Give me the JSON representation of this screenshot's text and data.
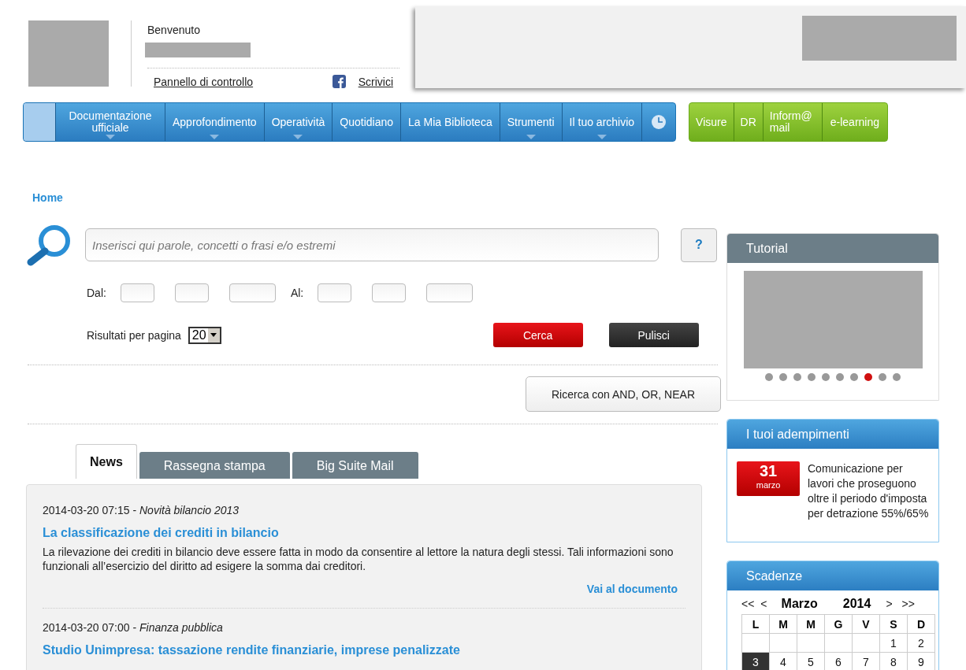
{
  "header": {
    "welcome": "Benvenuto",
    "links": [
      {
        "kind": "plain",
        "label": "Pannello di controllo"
      },
      {
        "kind": "facebook",
        "label": "Scrivici"
      }
    ]
  },
  "main_nav": [
    {
      "label": "Documentazione ufficiale",
      "dropdown": true
    },
    {
      "label": "Approfondimento",
      "dropdown": true
    },
    {
      "label": "Operatività",
      "dropdown": true
    },
    {
      "label": "Quotidiano",
      "dropdown": false
    },
    {
      "label": "La Mia Biblioteca",
      "dropdown": false
    },
    {
      "label": "Strumenti",
      "dropdown": true
    },
    {
      "label": "Il tuo archivio",
      "dropdown": true
    }
  ],
  "service_nav": [
    "Visure",
    "DR",
    "Inform@ mail",
    "e-learning"
  ],
  "breadcrumb": "Home",
  "search": {
    "placeholder": "Inserisci qui parole, concetti o frasi e/o estremi",
    "help": "?",
    "from_label": "Dal:",
    "to_label": "Al:",
    "per_page_label": "Risultati per pagina",
    "per_page": "20",
    "submit": "Cerca",
    "clear": "Pulisci",
    "advanced": "Ricerca con AND, OR, NEAR"
  },
  "tabs": [
    {
      "label": "News",
      "selected": true
    },
    {
      "label": "Rassegna stampa",
      "selected": false
    },
    {
      "label": "Big Suite Mail",
      "selected": false
    }
  ],
  "news": [
    {
      "meta": "2014-03-20 07:15 - *Novità bilancio 2013*",
      "title": "La classificazione dei crediti in bilancio",
      "summary": "La rilevazione dei crediti in bilancio deve essere fatta in modo da consentire al lettore la natura degli stessi. Tali informazioni sono funzionali all’esercizio del diritto ad esigere la somma dai creditori.",
      "link": "Vai al documento"
    },
    {
      "meta": "2014-03-20 07:00 - *Finanza pubblica*",
      "title": "Studio Unimpresa: tassazione rendite finanziarie, imprese penalizzate"
    }
  ],
  "tutorial": {
    "title": "Tutorial",
    "slides": [
      {
        "selected": false
      },
      {
        "selected": false
      },
      {
        "selected": false
      },
      {
        "selected": false
      },
      {
        "selected": false
      },
      {
        "selected": false
      },
      {
        "selected": false
      },
      {
        "selected": true
      },
      {
        "selected": false
      },
      {
        "selected": false
      }
    ]
  },
  "adempimenti": {
    "title": "I tuoi adempimenti",
    "day": "31",
    "month": "marzo",
    "text": "Comunicazione per lavori che proseguono oltre il periodo d'imposta per detrazione 55%/65%"
  },
  "scadenze": {
    "title": "Scadenze",
    "first": "<<",
    "prev": "<",
    "month": "Marzo",
    "year": "2014",
    "next": ">",
    "last": ">>",
    "weekdays": [
      "L",
      "M",
      "M",
      "G",
      "V",
      "S",
      "D"
    ],
    "weeks": [
      [
        {
          "day": "1",
          "selected": false
        },
        {
          "day": "2",
          "selected": false
        }
      ],
      [
        {
          "day": "3",
          "selected": true
        },
        {
          "day": "4",
          "selected": false
        },
        {
          "day": "5",
          "selected": false
        },
        {
          "day": "6",
          "selected": false
        },
        {
          "day": "7",
          "selected": false
        },
        {
          "day": "8",
          "selected": false
        },
        {
          "day": "9",
          "selected": false
        }
      ]
    ]
  }
}
